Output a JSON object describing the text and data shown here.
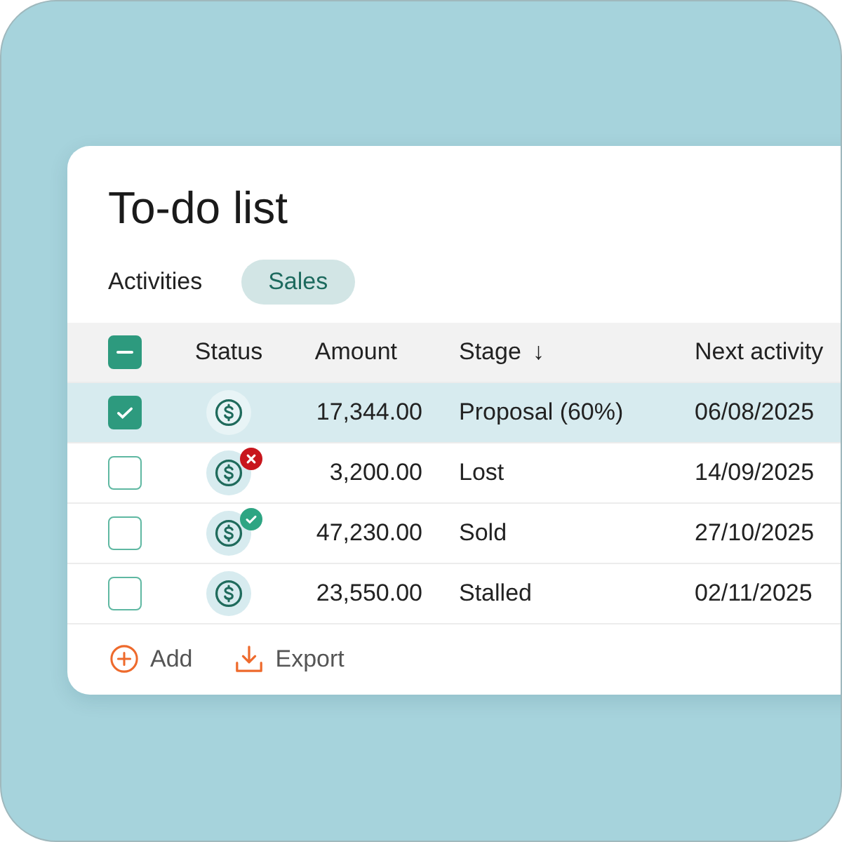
{
  "title": "To-do list",
  "tabs": [
    {
      "label": "Activities",
      "selected": false
    },
    {
      "label": "Sales",
      "selected": true
    }
  ],
  "table": {
    "select_all": {
      "checked": true,
      "partial": true
    },
    "columns": [
      {
        "label": "Status"
      },
      {
        "label": "Amount"
      },
      {
        "label": "Stage",
        "sort_mark": "↓"
      },
      {
        "label": "Next activity"
      }
    ],
    "rows": [
      {
        "selected": true,
        "checked": true,
        "kind": "plain",
        "amount": "17,344.00",
        "stage": "Proposal (60%)",
        "next": "06/08/2025"
      },
      {
        "selected": false,
        "checked": false,
        "kind": "lost",
        "amount": "3,200.00",
        "stage": "Lost",
        "next": "14/09/2025"
      },
      {
        "selected": false,
        "checked": false,
        "kind": "won",
        "amount": "47,230.00",
        "stage": "Sold",
        "next": "27/10/2025"
      },
      {
        "selected": false,
        "checked": false,
        "kind": "plain",
        "amount": "23,550.00",
        "stage": "Stalled",
        "next": "02/11/2025"
      }
    ]
  },
  "actions": [
    {
      "kind": "add",
      "label": "Add"
    },
    {
      "kind": "export",
      "label": "Export"
    }
  ]
}
